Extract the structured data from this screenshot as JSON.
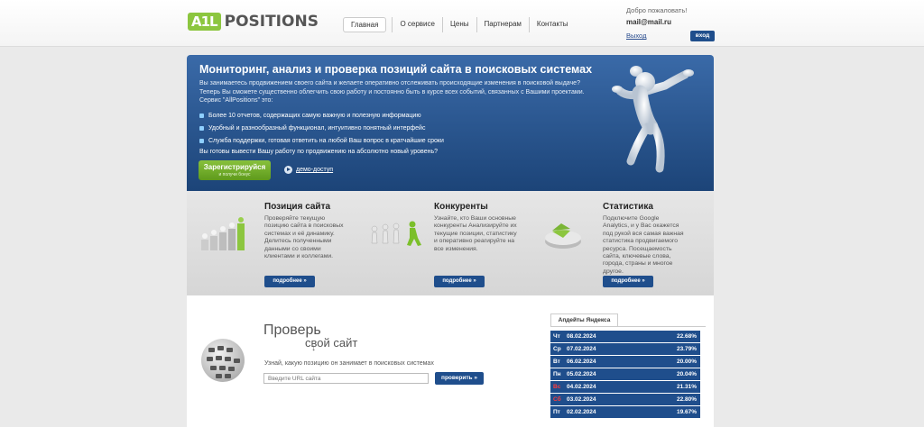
{
  "header": {
    "logo_badge": "A1L",
    "logo_text": "POSITIONS",
    "nav": [
      {
        "label": "Главная",
        "active": true
      },
      {
        "label": "О сервисе"
      },
      {
        "label": "Цены"
      },
      {
        "label": "Партнерам"
      },
      {
        "label": "Контакты"
      }
    ],
    "welcome": "Добро пожаловать!",
    "email": "mail@mail.ru",
    "logout": "Выход",
    "login": "вход"
  },
  "hero": {
    "title": "Мониторинг, анализ и проверка позиций сайта в поисковых системах",
    "intro": "Вы занимаетесь продвижением своего сайта и желаете оперативно отслеживать происходящие изменения в поисковой выдаче? Теперь Вы сможете существенно облегчить свою работу и постоянно быть в курсе всех событий, связанных с Вашими проектами. Сервис \"AllPositions\" это:",
    "bullets": [
      "Более 10 отчетов, содержащих самую важную и полезную информацию",
      "Удобный и разнообразный функционал, интуитивно понятный интерфейс",
      "Служба поддержки, готовая ответить на любой Ваш вопрос в кратчайшие сроки"
    ],
    "question": "Вы готовы вывести Вашу работу по продвижению на абсолютно новый уровень?",
    "register": "Зарегистрируйся",
    "register_sub": "и получи бонус",
    "demo": "демо-доступ"
  },
  "features": [
    {
      "title": "Позиция сайта",
      "text": "Проверяйте текущую позицию сайта в поисковых системах и её динамику. Делитесь полученными данными со своими клиентами и коллегами.",
      "more": "подробнее »"
    },
    {
      "title": "Конкуренты",
      "text": "Узнайте, кто Ваши основные конкуренты Анализируйте их текущие позиции, статистику и оперативно реагируйте на все изменения.",
      "more": "подробнее »"
    },
    {
      "title": "Статистика",
      "text": "Подключите Google Analytics, и у Вас окажется под рукой вся самая важная статистика продвигаемого ресурса. Посещаемость сайта, ключевые слова, города, страны и многое другое.",
      "more": "подробнее »"
    }
  ],
  "check": {
    "title": "Проверь",
    "title2": "свой сайт",
    "subtitle": "Узнай, какую позицию он занимает в поисковых системах",
    "placeholder": "Введите URL сайта",
    "button": "проверить »"
  },
  "updates": {
    "tab": "Апдейты Яндекса",
    "rows": [
      {
        "day": "Чт",
        "date": "08.02.2024",
        "pct": "22.68%",
        "weekend": false
      },
      {
        "day": "Ср",
        "date": "07.02.2024",
        "pct": "23.79%",
        "weekend": false
      },
      {
        "day": "Вт",
        "date": "06.02.2024",
        "pct": "20.00%",
        "weekend": false
      },
      {
        "day": "Пн",
        "date": "05.02.2024",
        "pct": "20.04%",
        "weekend": false
      },
      {
        "day": "Вс",
        "date": "04.02.2024",
        "pct": "21.31%",
        "weekend": true
      },
      {
        "day": "Сб",
        "date": "03.02.2024",
        "pct": "22.80%",
        "weekend": true
      },
      {
        "day": "Пт",
        "date": "02.02.2024",
        "pct": "19.67%",
        "weekend": false
      }
    ]
  }
}
